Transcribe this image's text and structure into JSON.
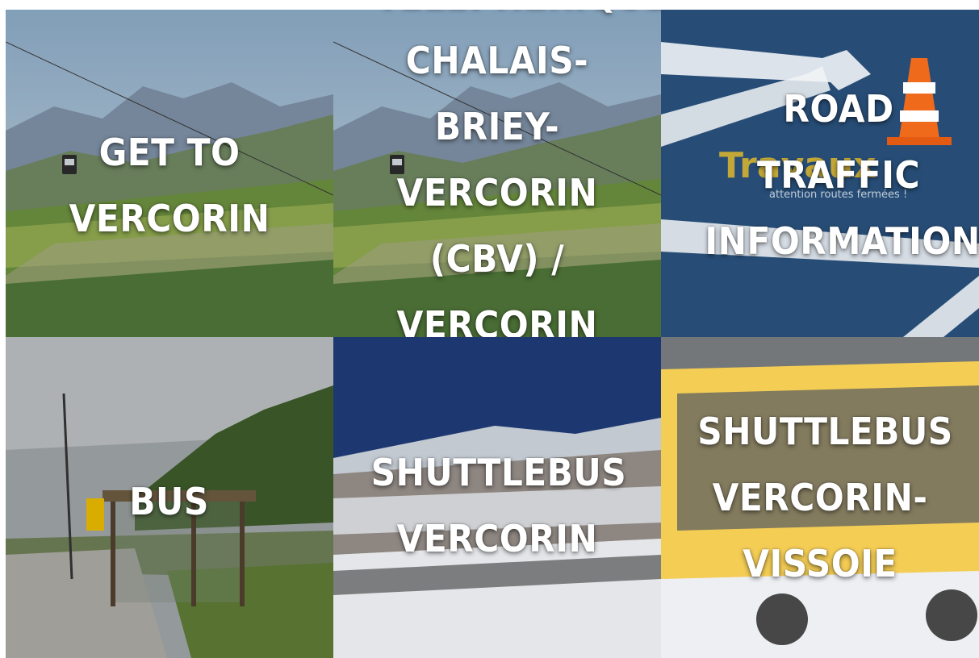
{
  "tiles": [
    {
      "title": "Get to Vercorin",
      "scene": "valley-cablecar"
    },
    {
      "title": "Téléphérique Chalais-Briey-Vercorin (CBV) / Vercorin",
      "scene": "valley-cablecar"
    },
    {
      "title": "Road traffic information",
      "scene": "road-works"
    },
    {
      "title": "Bus",
      "scene": "bus-stop"
    },
    {
      "title": "Shuttlebus Vercorin",
      "scene": "snow-village"
    },
    {
      "title": "Shuttlebus Vercorin-Vissoie",
      "scene": "postbus-snow"
    }
  ],
  "roadsign": {
    "word": "Travaux",
    "sub": "attention routes fermées !"
  },
  "colors": {
    "title_text": "#ffffff",
    "postbus_yellow": "#f2c230",
    "traffic_cone": "#f06a1c"
  }
}
